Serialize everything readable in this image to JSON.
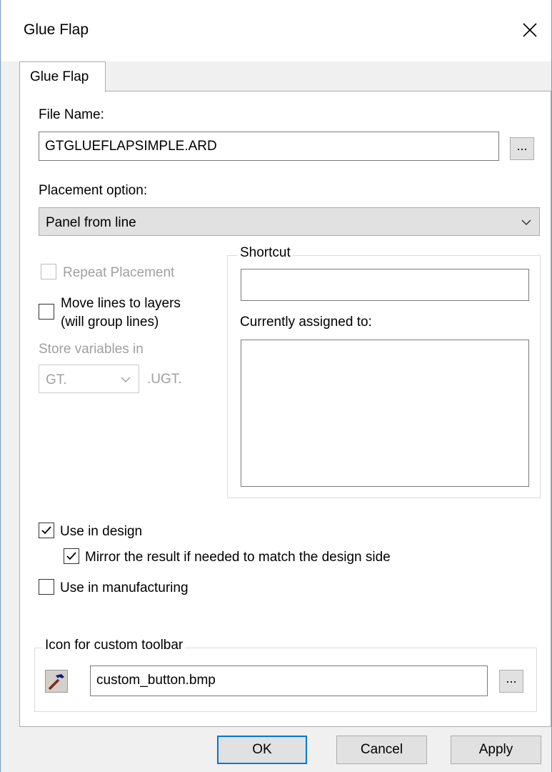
{
  "window": {
    "title": "Glue Flap"
  },
  "tab": {
    "label": "Glue Flap"
  },
  "file": {
    "label": "File Name:",
    "value": "GTGLUEFLAPSIMPLE.ARD",
    "browse_label": "..."
  },
  "placement": {
    "label": "Placement option:",
    "selected": "Panel from line"
  },
  "repeat": {
    "label": "Repeat Placement",
    "checked": false,
    "enabled": false
  },
  "move_lines": {
    "label_line1": "Move lines to layers",
    "label_line2": "(will group lines)",
    "checked": false
  },
  "store_vars": {
    "label": "Store variables in",
    "selected": "GT.",
    "suffix": ".UGT."
  },
  "shortcut": {
    "group_title": "Shortcut",
    "value": "",
    "assigned_label": "Currently assigned to:"
  },
  "use_design": {
    "label": "Use in design",
    "checked": true
  },
  "mirror": {
    "label": "Mirror the result if needed to match the design side",
    "checked": true
  },
  "use_manufacturing": {
    "label": "Use in manufacturing",
    "checked": false
  },
  "icon_group": {
    "title": "Icon for custom toolbar",
    "file": "custom_button.bmp",
    "browse_label": "...",
    "icon": "hammer-icon"
  },
  "buttons": {
    "ok": "OK",
    "cancel": "Cancel",
    "apply": "Apply"
  },
  "colors": {
    "accent": "#0078d7",
    "dialog_bg": "#f0f0f0",
    "button_bg": "#e1e1e1"
  }
}
